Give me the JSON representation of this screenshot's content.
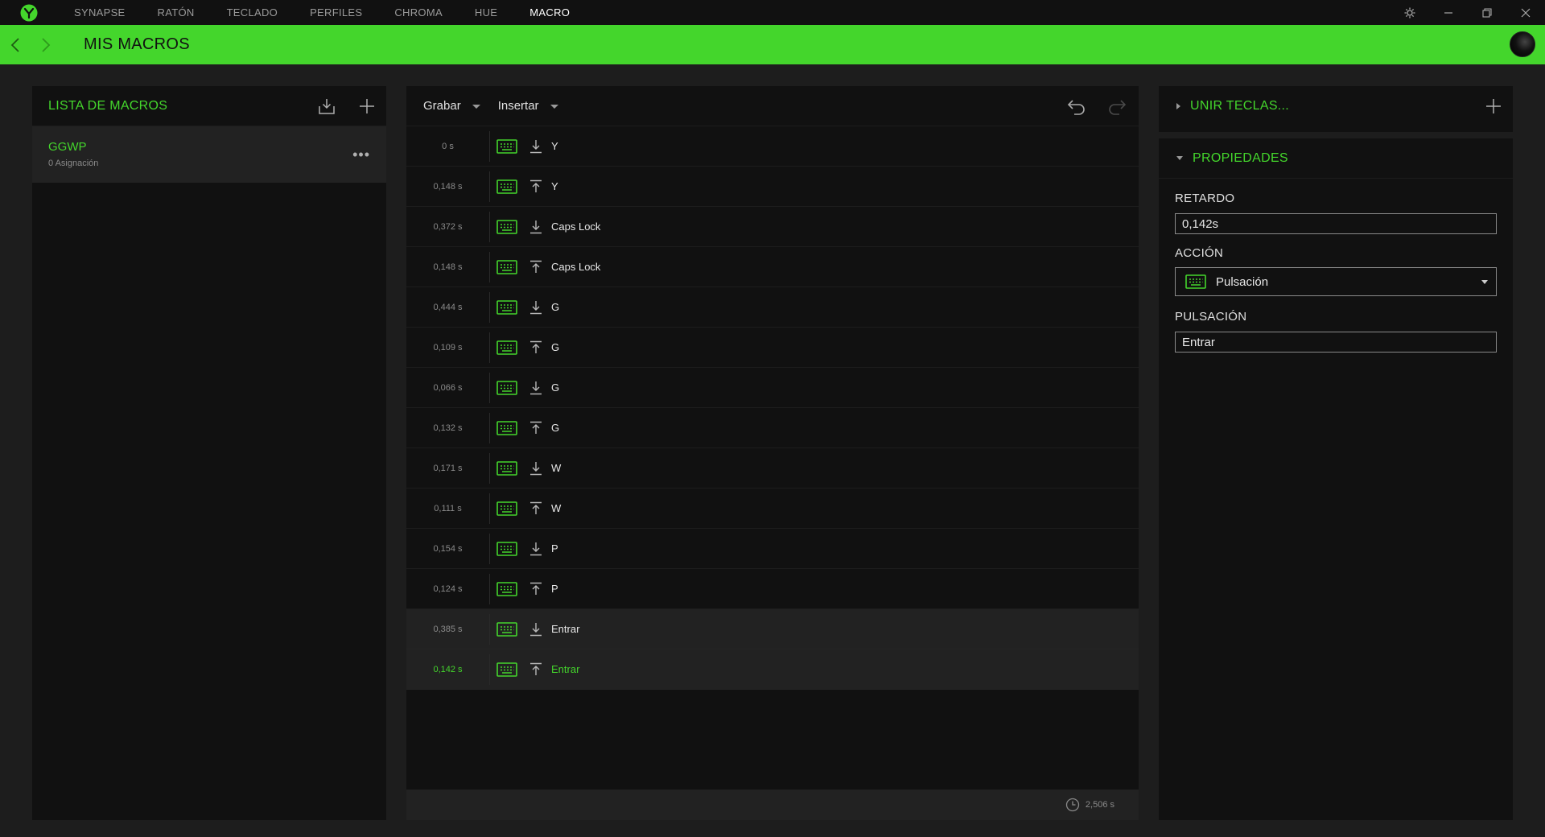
{
  "nav": {
    "items": [
      "SYNAPSE",
      "RATÓN",
      "TECLADO",
      "PERFILES",
      "CHROMA",
      "HUE",
      "MACRO"
    ],
    "active": "MACRO"
  },
  "header": {
    "title": "MIS MACROS"
  },
  "colors": {
    "accent": "#44d62c",
    "panel": "#111111",
    "background": "#1d1d1d",
    "row_alt": "#222222"
  },
  "macro_list": {
    "title": "LISTA DE MACROS",
    "items": [
      {
        "name": "GGWP",
        "sub": "0 Asignación"
      }
    ]
  },
  "editor": {
    "record_label": "Grabar",
    "insert_label": "Insertar",
    "events": [
      {
        "delay": "0 s",
        "dir": "down",
        "key": "Y"
      },
      {
        "delay": "0,148 s",
        "dir": "up",
        "key": "Y"
      },
      {
        "delay": "0,372 s",
        "dir": "down",
        "key": "Caps Lock"
      },
      {
        "delay": "0,148 s",
        "dir": "up",
        "key": "Caps Lock"
      },
      {
        "delay": "0,444 s",
        "dir": "down",
        "key": "G"
      },
      {
        "delay": "0,109 s",
        "dir": "up",
        "key": "G"
      },
      {
        "delay": "0,066 s",
        "dir": "down",
        "key": "G"
      },
      {
        "delay": "0,132 s",
        "dir": "up",
        "key": "G"
      },
      {
        "delay": "0,171 s",
        "dir": "down",
        "key": "W"
      },
      {
        "delay": "0,111 s",
        "dir": "up",
        "key": "W"
      },
      {
        "delay": "0,154 s",
        "dir": "down",
        "key": "P"
      },
      {
        "delay": "0,124 s",
        "dir": "up",
        "key": "P"
      },
      {
        "delay": "0,385 s",
        "dir": "down",
        "key": "Entrar"
      },
      {
        "delay": "0,142 s",
        "dir": "up",
        "key": "Entrar"
      }
    ],
    "selected_index": 13,
    "total_time": "2,506 s"
  },
  "join_keys": {
    "title": "UNIR TECLAS..."
  },
  "properties": {
    "title": "PROPIEDADES",
    "delay_label": "RETARDO",
    "delay_value": "0,142s",
    "action_label": "ACCIÓN",
    "action_value": "Pulsación",
    "key_label": "PULSACIÓN",
    "key_value": "Entrar"
  },
  "icons": {
    "logo": "razer-logo-icon",
    "settings": "gear-icon",
    "minimize": "minimize-icon",
    "maximize": "restore-icon",
    "close": "close-icon",
    "back": "chevron-left-icon",
    "forward": "chevron-right-icon",
    "import": "import-icon",
    "add": "plus-icon",
    "more": "more-icon",
    "undo": "undo-icon",
    "redo": "redo-icon",
    "keyboard": "keyboard-icon",
    "key_down": "arrow-down-icon",
    "key_up": "arrow-up-icon",
    "clock": "clock-icon"
  }
}
